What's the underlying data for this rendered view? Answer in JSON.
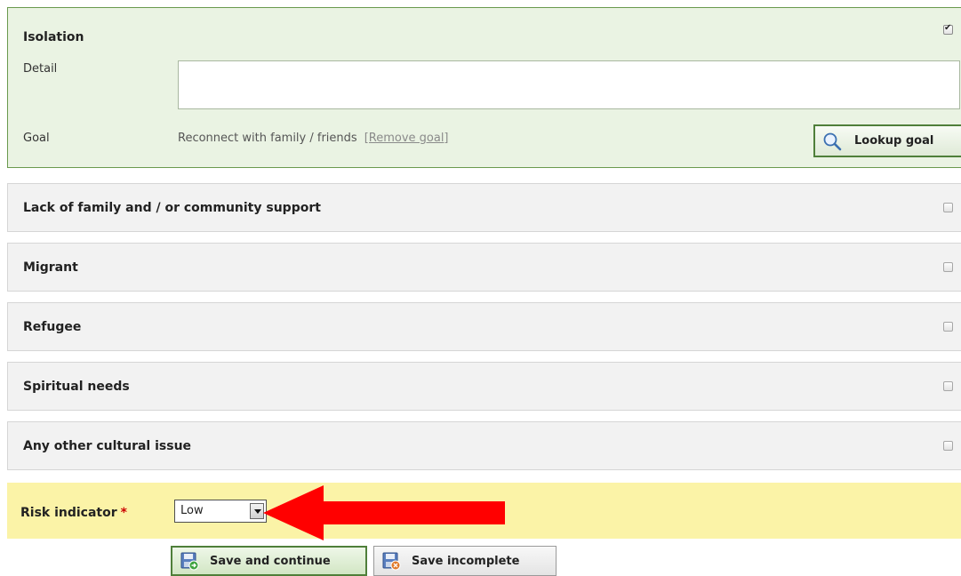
{
  "open_section": {
    "title": "Isolation",
    "checked": true,
    "detail_label": "Detail",
    "detail_value": "",
    "goal_label": "Goal",
    "goal_value": "Reconnect with family / friends",
    "remove_goal_label": "[Remove goal]",
    "lookup_goal_label": "Lookup goal"
  },
  "sections": [
    {
      "title": "Lack of family and / or community support",
      "checked": false
    },
    {
      "title": "Migrant",
      "checked": false
    },
    {
      "title": "Refugee",
      "checked": false
    },
    {
      "title": "Spiritual needs",
      "checked": false
    },
    {
      "title": "Any other cultural issue",
      "checked": false
    }
  ],
  "risk": {
    "label": "Risk indicator",
    "required_mark": "*",
    "selected": "Low"
  },
  "buttons": {
    "save_continue": "Save and continue",
    "save_incomplete": "Save incomplete"
  },
  "colors": {
    "open_bg": "#eaf3e3",
    "row_bg": "#f2f2f2",
    "risk_bg": "#fbf3a7",
    "arrow": "#ff0000"
  }
}
